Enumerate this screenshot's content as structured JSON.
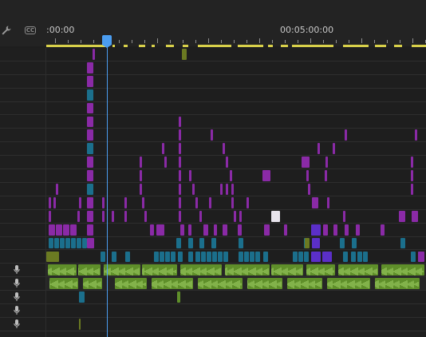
{
  "toolbar": {
    "settings_icon": "wrench-icon",
    "captions_label": "CC"
  },
  "ruler": {
    "start_timecode": ":00:00",
    "mid_timecode": "00:05:00:00"
  },
  "markers": [
    {
      "name": "marker-teal",
      "color": "#2ed6c6"
    },
    {
      "name": "marker-orange",
      "color": "#e0a23a"
    }
  ],
  "colors": {
    "background": "#1e1e1e",
    "header": "#232323",
    "playhead": "#4b9df0",
    "work_area": "#d8d04a",
    "clip_purple": "#8a2aa6",
    "clip_purple_light": "#a54fc4",
    "clip_blue": "#1b6f8c",
    "clip_indigo": "#5b2fc8",
    "clip_olive": "#6b7a22",
    "clip_green": "#5f8f2a",
    "clip_green_wave": "#a4d46a",
    "clip_white": "#e8e4ec"
  },
  "audio_tracks": [
    "mic-icon",
    "mic-icon",
    "mic-icon",
    "mic-icon",
    "mic-icon"
  ]
}
